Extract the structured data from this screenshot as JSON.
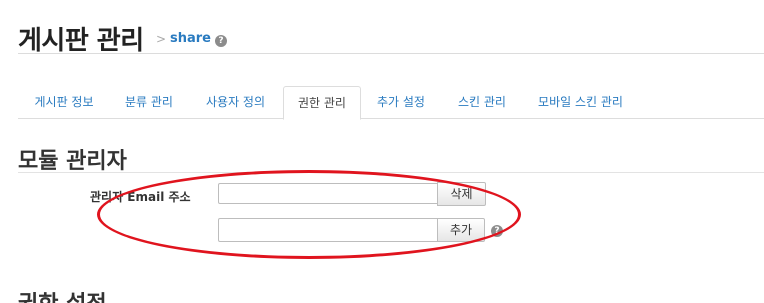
{
  "header": {
    "title": "게시판 관리",
    "separator": ">",
    "module_link": "share",
    "help_glyph": "?"
  },
  "tabs": [
    {
      "label": "게시판 정보",
      "active": false
    },
    {
      "label": "분류 관리",
      "active": false
    },
    {
      "label": "사용자 정의",
      "active": false
    },
    {
      "label": "권한 관리",
      "active": true
    },
    {
      "label": "추가 설정",
      "active": false
    },
    {
      "label": "스킨 관리",
      "active": false
    },
    {
      "label": "모바일 스킨 관리",
      "active": false
    }
  ],
  "module_admin": {
    "section_title": "모듈 관리자",
    "field_label": "관리자 Email 주소",
    "existing_email_value": "",
    "new_email_value": "",
    "delete_button": "삭제",
    "add_button": "추가",
    "help_glyph": "?"
  },
  "permissions": {
    "section_title": "권한 설정"
  },
  "colors": {
    "link": "#2a7bc0",
    "annotation": "#e0141e"
  }
}
